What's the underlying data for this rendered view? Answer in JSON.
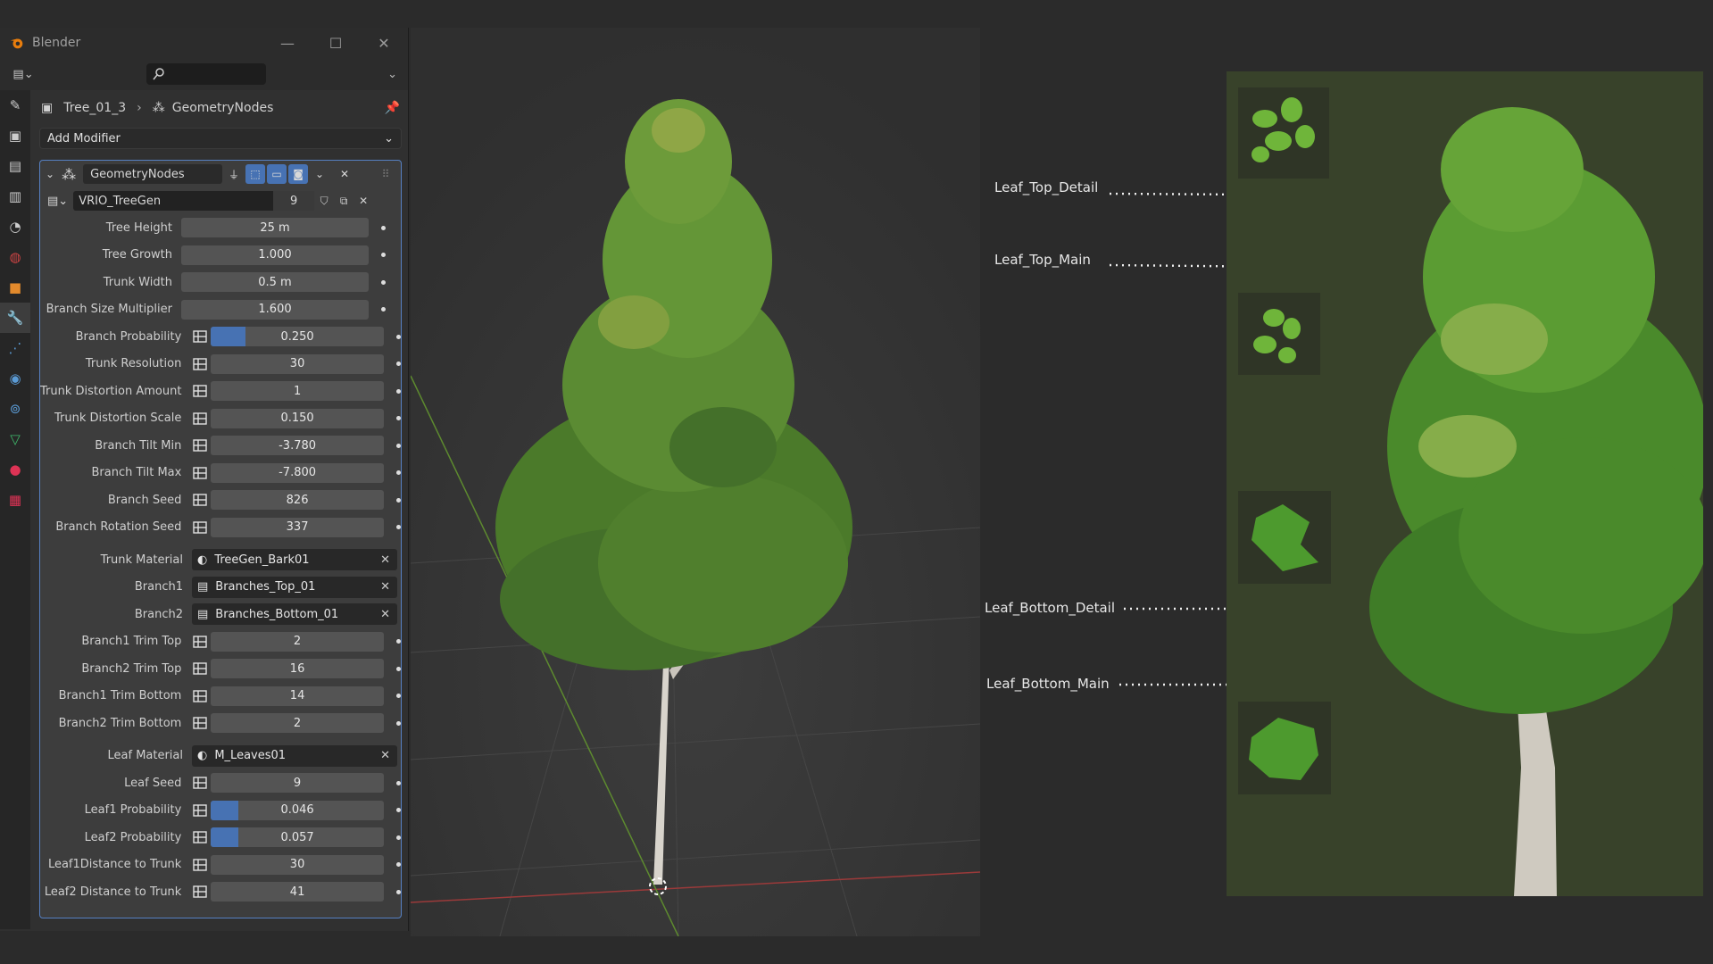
{
  "window": {
    "title": "Blender"
  },
  "breadcrumb": {
    "object": "Tree_01_3",
    "modifier": "GeometryNodes"
  },
  "add_modifier": {
    "label": "Add Modifier"
  },
  "modifier": {
    "name": "GeometryNodes",
    "node_group": "VRIO_TreeGen",
    "users": "9"
  },
  "params": [
    {
      "label": "Tree Height",
      "value": "25 m"
    },
    {
      "label": "Tree Growth",
      "value": "1.000"
    },
    {
      "label": "Trunk Width",
      "value": "0.5 m"
    },
    {
      "label": "Branch Size Multiplier",
      "value": "1.600"
    },
    {
      "label": "Branch Probability",
      "value": "0.250",
      "fill": 0.2
    },
    {
      "label": "Trunk Resolution",
      "value": "30"
    },
    {
      "label": "Trunk Distortion Amount",
      "value": "1"
    },
    {
      "label": "Trunk Distortion Scale",
      "value": "0.150"
    },
    {
      "label": "Branch Tilt Min",
      "value": "-3.780"
    },
    {
      "label": "Branch Tilt Max",
      "value": "-7.800"
    },
    {
      "label": "Branch Seed",
      "value": "826"
    },
    {
      "label": "Branch Rotation Seed",
      "value": "337"
    }
  ],
  "materials": {
    "trunk": {
      "label": "Trunk Material",
      "value": "TreeGen_Bark01"
    },
    "branch1": {
      "label": "Branch1",
      "value": "Branches_Top_01"
    },
    "branch2": {
      "label": "Branch2",
      "value": "Branches_Bottom_01"
    },
    "leaf": {
      "label": "Leaf Material",
      "value": "M_Leaves01"
    }
  },
  "trim_params": [
    {
      "label": "Branch1 Trim Top",
      "value": "2"
    },
    {
      "label": "Branch2 Trim Top",
      "value": "16"
    },
    {
      "label": "Branch1 Trim Bottom",
      "value": "14"
    },
    {
      "label": "Branch2 Trim Bottom",
      "value": "2"
    }
  ],
  "leaf_params": [
    {
      "label": "Leaf Seed",
      "value": "9"
    },
    {
      "label": "Leaf1 Probability",
      "value": "0.046",
      "fill": 0.046
    },
    {
      "label": "Leaf2 Probability",
      "value": "0.057",
      "fill": 0.057
    },
    {
      "label": "Leaf1Distance to Trunk",
      "value": "30"
    },
    {
      "label": "Leaf2 Distance to Trunk",
      "value": "41"
    }
  ],
  "annotations": {
    "leaf_top_detail": "Leaf_Top_Detail",
    "leaf_top_main": "Leaf_Top_Main",
    "leaf_bottom_detail": "Leaf_Bottom_Detail",
    "leaf_bottom_main": "Leaf_Bottom_Main"
  },
  "colors": {
    "accent": "#4772b3",
    "panel": "#3d3d3d",
    "viewport": "#3a3a3a",
    "reference_bg": "#38422a"
  }
}
